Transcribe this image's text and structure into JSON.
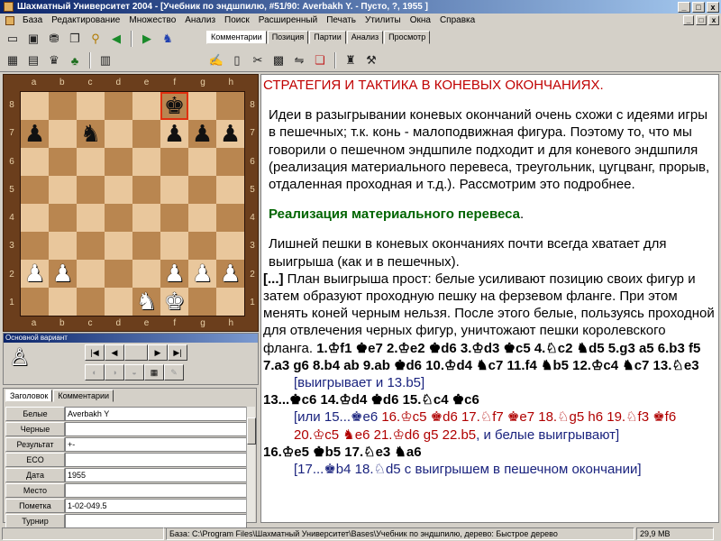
{
  "window": {
    "title": "Шахматный Университет 2004 - [Учебник по эндшпилю, #51/90: Averbakh Y. - Пусто, ?, 1955 ]",
    "controls": [
      "_",
      "□",
      "x"
    ]
  },
  "menu": [
    "База",
    "Редактирование",
    "Множество",
    "Анализ",
    "Поиск",
    "Расширенный",
    "Печать",
    "Утилиты",
    "Окна",
    "Справка"
  ],
  "toolbar": {
    "row1_icons": [
      "new-icon",
      "open-icon",
      "database-icon",
      "copy-icon",
      "zoom-icon",
      "back-icon",
      "forward-icon",
      "engine-icon"
    ],
    "row2_icons": [
      "grid-icon",
      "board-icon",
      "trophy-icon",
      "tree-icon",
      "layout-icon",
      "abc-icon",
      "calc-icon",
      "scissors-icon",
      "checker-icon",
      "flip-icon",
      "stack-icon",
      "pieces-icon",
      "tools-icon"
    ]
  },
  "tabs": [
    "Комментарии",
    "Позиция",
    "Партии",
    "Анализ",
    "Просмотр"
  ],
  "board": {
    "files": [
      "a",
      "b",
      "c",
      "d",
      "e",
      "f",
      "g",
      "h"
    ],
    "ranks": [
      "8",
      "7",
      "6",
      "5",
      "4",
      "3",
      "2",
      "1"
    ],
    "pieces": {
      "f8": "bk",
      "a7": "bp",
      "c7": "bn",
      "f7": "bp",
      "g7": "bp",
      "h7": "bp",
      "a2": "wp",
      "b2": "wp",
      "f2": "wp",
      "g2": "wp",
      "h2": "wp",
      "e1": "wn",
      "f1": "wk"
    },
    "highlight": "f8",
    "colors": {
      "light": "#e9c79c",
      "dark": "#b98650",
      "frame": "#6b3e1c",
      "highlight": "#e03010"
    }
  },
  "variant": {
    "title": "Основной вариант",
    "nav_row1": [
      "|◀",
      "◀",
      "",
      "▶",
      "▶|"
    ],
    "nav_row2": [
      "◐",
      "◑",
      "◒",
      "▦",
      "✎"
    ]
  },
  "game_info": {
    "tabs": [
      "Заголовок",
      "Комментарии"
    ],
    "rows": [
      {
        "label": "Белые",
        "value": "Averbakh Y"
      },
      {
        "label": "Черные",
        "value": ""
      },
      {
        "label": "Результат",
        "value": "+-"
      },
      {
        "label": "ECO",
        "value": ""
      },
      {
        "label": "Дата",
        "value": "1955"
      },
      {
        "label": "Место",
        "value": ""
      },
      {
        "label": "Пометка",
        "value": "1-02-049.5"
      },
      {
        "label": "Турнир",
        "value": ""
      }
    ]
  },
  "text": {
    "heading": "СТРАТЕГИЯ И ТАКТИКА В КОНЕВЫХ ОКОНЧАНИЯХ.",
    "para1": "Идеи в разыгрывании коневых окончаний очень схожи с идеями игры в пешечных; т.к. конь - малоподвижная фигура. Поэтому то, что мы говорили о пешечном эндшпиле подходит и для коневого эндшпиля (реализация материального перевеса, треугольник, цугцванг, прорыв, отдаленная проходная и т.д.). Рассмотрим это подробнее.",
    "subheading": "Реализация материального перевеса",
    "para2": "Лишней пешки в коневых окончаниях почти всегда хватает для выигрыша (как и в пешечных).",
    "bracket": "[...]",
    "para3": "План выигрыша прост: белые усиливают позицию своих фигур и затем образуют проходную пешку на ферзевом фланге. При этом менять коней черным нельзя. После этого белые, пользуясь проходной для отвлечения черных фигур, уничтожают пешки королевского фланга.",
    "moves1": "1.♔f1 ♚e7 2.♔e2 ♚d6 3.♔d3 ♚c5 4.♘c2 ♞d5 5.g3 a5 6.b3 f5 7.a3 g6 8.b4 ab 9.ab ♚d6 10.♔d4 ♞c7 11.f4 ♞b5 12.♔c4 ♞c7 13.♘e3",
    "var1": "[выигрывает и 13.b5]",
    "moves2": "13...♚c6 14.♔d4 ♚d6 15.♘c4 ♚c6",
    "var2_open": "[или 15...♚e6 ",
    "var2_red": "16.♔c5 ♚d6 17.♘f7 ♚e7 18.♘g5 h6 19.♘f3 ♚f6 20.♔c5 ♞e6 21.♔d6 g5 22.b5",
    "var2_close": ", и белые выигрывают]",
    "moves3": "16.♔e5 ♚b5 17.♘e3 ♞a6",
    "var3": "[17...♚b4 18.♘d5 с выигрышем в пешечном окончании]"
  },
  "status": {
    "path": "База: C:\\Program Files\\Шахматный Университет\\Bases\\Учебник по эндшпилю, дерево: Быстрое дерево",
    "size": "29,9 MB"
  }
}
